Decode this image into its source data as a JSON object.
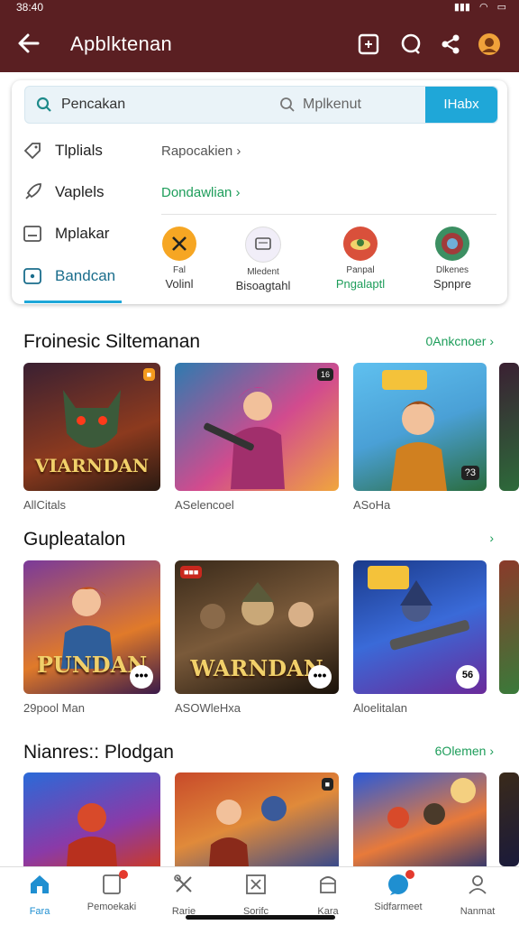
{
  "status": {
    "time": "38:40"
  },
  "appbar": {
    "title": "Apblktenan"
  },
  "search": {
    "query": "Pencakan",
    "secondary": "Mplkenut",
    "button_label": "IHabx"
  },
  "menu": [
    {
      "label": "Tlplials"
    },
    {
      "label": "Vaplels"
    },
    {
      "label": "Mplakar"
    },
    {
      "label": "Bandcan"
    }
  ],
  "links": {
    "link1": "Rapocakien ›",
    "link2": "Dondawlian ›"
  },
  "quick_actions": [
    {
      "line1": "Fal",
      "line2": "Volinl"
    },
    {
      "line1": "Mledent",
      "line2": "Bisoagtahl"
    },
    {
      "line1": "Panpal",
      "line2": "Pngalaptl"
    },
    {
      "line1": "Dlkenes",
      "line2": "Spnpre"
    }
  ],
  "sections": [
    {
      "title": "Froinesic Siltemanan",
      "see_all": "0Ankcnoer ›",
      "items": [
        {
          "art_text": "VIARNDAN",
          "badge": "",
          "caption": "AllCitals"
        },
        {
          "art_text": "",
          "badge": "16",
          "caption": "ASelencoel"
        },
        {
          "art_text": "",
          "badge": "?3",
          "caption": "ASoHa"
        }
      ]
    },
    {
      "title": "Gupleatalon",
      "see_all": "›",
      "items": [
        {
          "art_text": "PUNDAN",
          "badge": "",
          "caption": "29pool Man"
        },
        {
          "art_text": "WARNDAN",
          "badge": "",
          "caption": "ASOWleHxa"
        },
        {
          "art_text": "",
          "badge": "56",
          "caption": "Aloelitalan"
        }
      ]
    },
    {
      "title": "Nianres:: Plodgan",
      "see_all": "6Olemen ›"
    }
  ],
  "bottom_nav": [
    {
      "label": "Fara"
    },
    {
      "label": "Pemoekaki"
    },
    {
      "label": "Rarie"
    },
    {
      "label": "Sorifc"
    },
    {
      "label": "Kara"
    },
    {
      "label": "Sidfarmeet"
    },
    {
      "label": "Nanmat"
    }
  ],
  "colors": {
    "appbar": "#5a1f22",
    "accent": "#1fa7d8",
    "link_green": "#1d9d5a"
  }
}
